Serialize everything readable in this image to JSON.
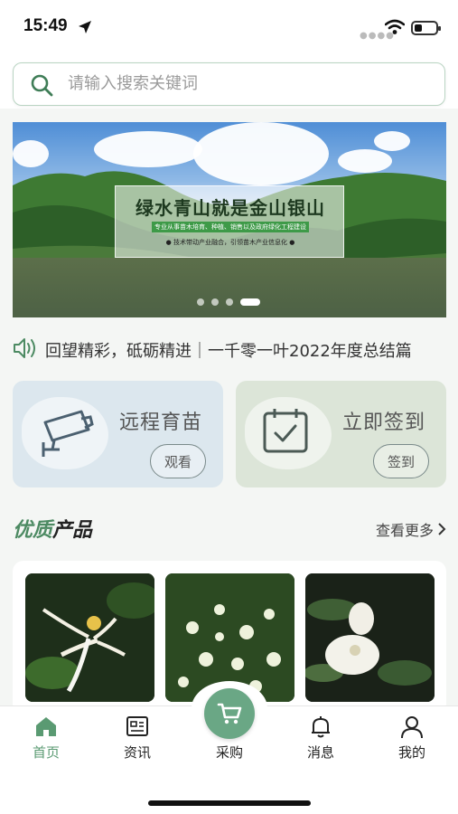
{
  "status_bar": {
    "time": "15:49",
    "battery_level": 0.35
  },
  "search": {
    "placeholder": "请输入搜索关键词"
  },
  "banner": {
    "title": "绿水青山就是金山银山",
    "subtitle_line1": "专业从事苗木培育、种植、销售以及政府绿化工程建设",
    "subtitle_line2": "● 技术带动产业融合，引领苗木产业信息化 ●",
    "active_slide": 4,
    "slide_count": 4
  },
  "notice": {
    "text": "回望精彩，砥砺精进｜一千零一叶2022年度总结篇",
    "icon": "speaker-icon"
  },
  "features": [
    {
      "title": "远程育苗",
      "button": "观看",
      "icon": "camera-icon"
    },
    {
      "title": "立即签到",
      "button": "签到",
      "icon": "calendar-check-icon"
    }
  ],
  "products_section": {
    "title_accent": "优质",
    "title_rest": "产品",
    "more_label": "查看更多"
  },
  "tab_bar": {
    "items": [
      {
        "label": "首页",
        "icon": "home-icon",
        "active": true
      },
      {
        "label": "资讯",
        "icon": "news-icon",
        "active": false
      },
      {
        "label": "采购",
        "icon": "cart-icon",
        "active": false
      },
      {
        "label": "消息",
        "icon": "bell-icon",
        "active": false
      },
      {
        "label": "我的",
        "icon": "user-icon",
        "active": false
      }
    ]
  },
  "colors": {
    "brand_green": "#5a9a72",
    "cart_button": "#6aa785"
  }
}
